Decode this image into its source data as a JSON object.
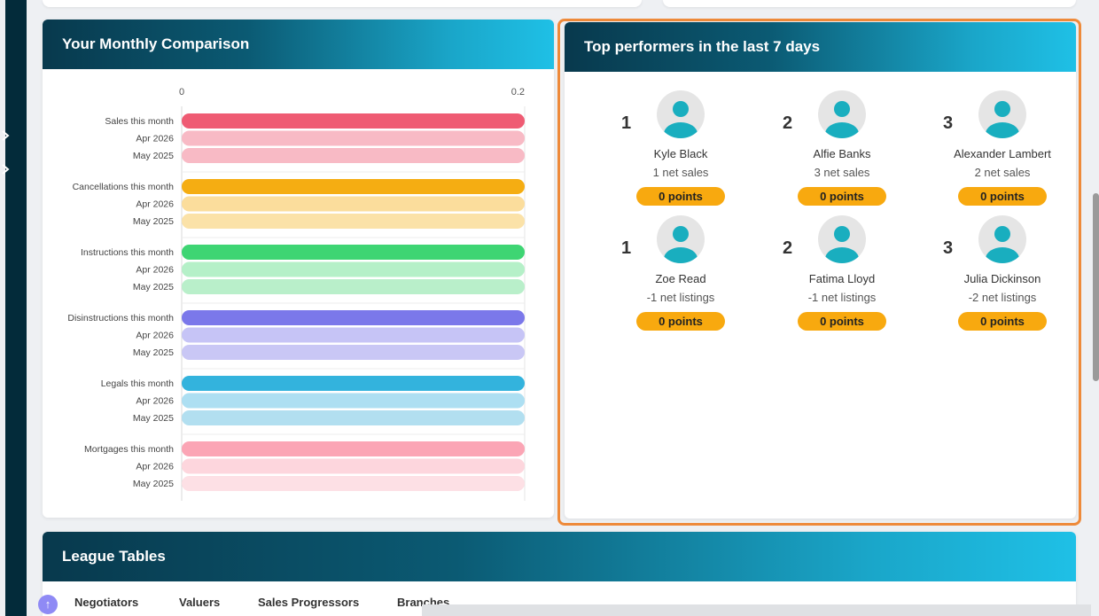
{
  "comparison": {
    "title": "Your Monthly Comparison",
    "chart_data": {
      "type": "bar",
      "orientation": "horizontal",
      "axis_ticks": [
        "0",
        "0.2"
      ],
      "xlim": [
        0,
        0.2
      ],
      "groups": [
        {
          "label": "Sales this month",
          "color": "#ef5b73",
          "bars": [
            {
              "label": "Sales this month",
              "value": 0.2
            },
            {
              "label": "Apr 2026",
              "value": 0.2
            },
            {
              "label": "May 2025",
              "value": 0.2
            }
          ]
        },
        {
          "label": "Cancellations this month",
          "color": "#f5ad12",
          "bars": [
            {
              "label": "Cancellations this month",
              "value": 0.2
            },
            {
              "label": "Apr 2026",
              "value": 0.2
            },
            {
              "label": "May 2025",
              "value": 0.2
            }
          ]
        },
        {
          "label": "Instructions this month",
          "color": "#3ed573",
          "bars": [
            {
              "label": "Instructions this month",
              "value": 0.2
            },
            {
              "label": "Apr 2026",
              "value": 0.2
            },
            {
              "label": "May 2025",
              "value": 0.2
            }
          ]
        },
        {
          "label": "Disinstructions this month",
          "color": "#7b78ea",
          "bars": [
            {
              "label": "Disinstructions this month",
              "value": 0.2
            },
            {
              "label": "Apr 2026",
              "value": 0.2
            },
            {
              "label": "May 2025",
              "value": 0.2
            }
          ]
        },
        {
          "label": "Legals this month",
          "color": "#33b3dd",
          "bars": [
            {
              "label": "Legals this month",
              "value": 0.2
            },
            {
              "label": "Apr 2026",
              "value": 0.2
            },
            {
              "label": "May 2025",
              "value": 0.2
            }
          ]
        },
        {
          "label": "Mortgages this month",
          "color": "#fba5b5",
          "bars": [
            {
              "label": "Mortgages this month",
              "value": 0.2
            },
            {
              "label": "Apr 2026",
              "value": 0.2
            },
            {
              "label": "May 2025",
              "value": 0.2
            }
          ]
        }
      ],
      "faded_colors": [
        [
          "#f8bac5",
          "#f8bac5"
        ],
        [
          "#fbdd9c",
          "#fbe2a8"
        ],
        [
          "#b5f0c8",
          "#b9efca"
        ],
        [
          "#c6c4f6",
          "#c9c7f5"
        ],
        [
          "#addff2",
          "#b2dff0"
        ],
        [
          "#fdd6dd",
          "#fde0e5"
        ]
      ]
    }
  },
  "performers": {
    "title": "Top performers in the last 7 days",
    "people": [
      {
        "rank": "1",
        "name": "Kyle Black",
        "stat": "1 net sales",
        "points": "0 points"
      },
      {
        "rank": "2",
        "name": "Alfie Banks",
        "stat": "3 net sales",
        "points": "0 points"
      },
      {
        "rank": "3",
        "name": "Alexander Lambert",
        "stat": "2 net sales",
        "points": "0 points"
      },
      {
        "rank": "1",
        "name": "Zoe Read",
        "stat": "-1 net listings",
        "points": "0 points"
      },
      {
        "rank": "2",
        "name": "Fatima Lloyd",
        "stat": "-1 net listings",
        "points": "0 points"
      },
      {
        "rank": "3",
        "name": "Julia Dickinson",
        "stat": "-2 net listings",
        "points": "0 points"
      }
    ],
    "accent_color": "#ee8a3a",
    "points_color": "#f8a90f",
    "avatar_color": "#19aebf"
  },
  "league": {
    "title": "League Tables",
    "tabs": [
      "Negotiators",
      "Valuers",
      "Sales Progressors",
      "Branches"
    ]
  },
  "icons": {
    "rail": "chevron-right-icon",
    "scroll_up": "arrow-up-icon",
    "avatar": "user-avatar-icon"
  }
}
